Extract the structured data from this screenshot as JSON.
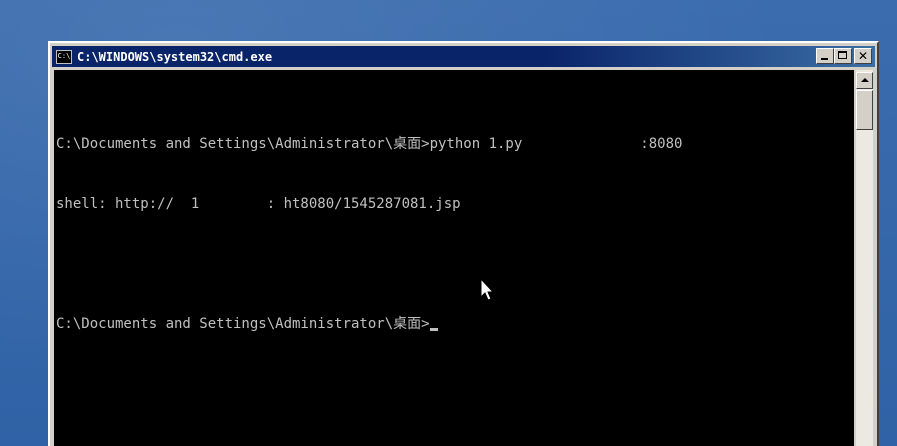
{
  "window": {
    "title": "C:\\WINDOWS\\system32\\cmd.exe",
    "icon_label": "C:\\"
  },
  "console": {
    "lines": [
      "C:\\Documents and Settings\\Administrator\\桌面>python 1.py              :8080",
      "shell: http://  1        : ht8080/1545287081.jsp",
      "",
      "C:\\Documents and Settings\\Administrator\\桌面>"
    ]
  },
  "icons": {
    "app": "cmd-icon",
    "minimize": "minimize-icon",
    "maximize": "maximize-icon",
    "close": "close-icon",
    "scroll_up": "arrow-up-icon",
    "pointer": "mouse-pointer-icon"
  },
  "colors": {
    "title_bar": "#0a246a",
    "console_bg": "#000000",
    "console_text": "#c0c0c0",
    "desktop": "#3a6fb0"
  }
}
